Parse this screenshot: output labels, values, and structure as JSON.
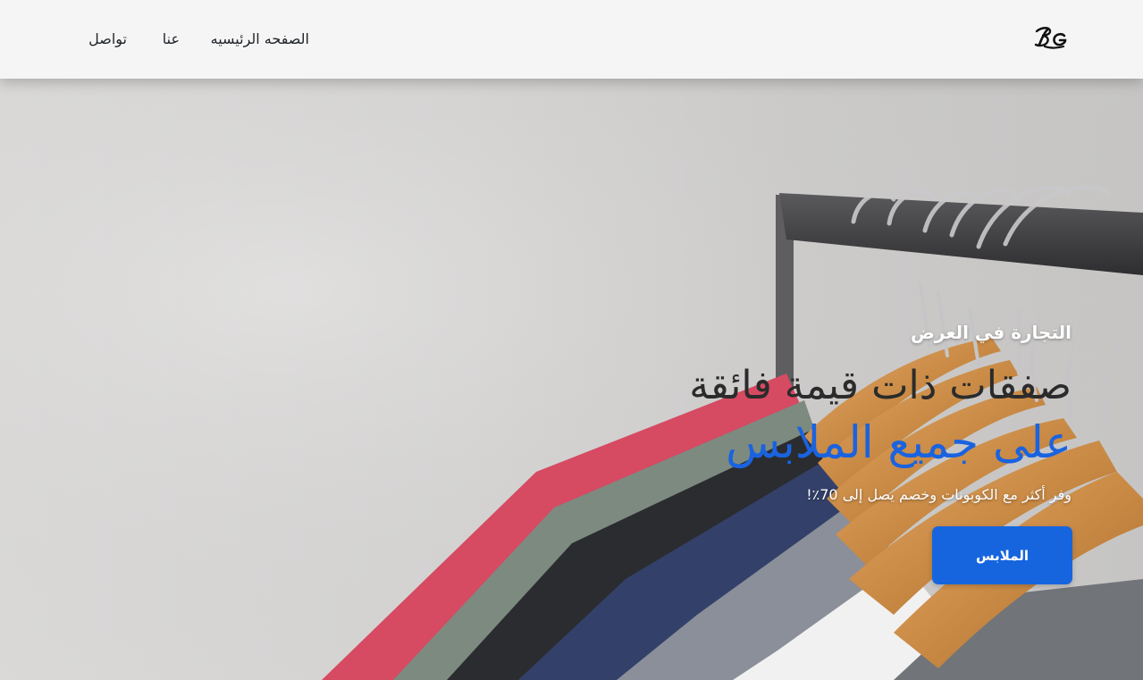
{
  "brand": {
    "logo_text": "BG"
  },
  "nav": {
    "home": "الصفحه الرئيسيه",
    "about": "عنا",
    "contact": "تواصل"
  },
  "hero": {
    "eyebrow": "التجارة في العرض",
    "title_line1": "صفقات ذات قيمة فائقة",
    "title_line2": "على جميع الملابس",
    "subtitle": "وفر أكثر مع الكوبونات وخصم يصل إلى 70٪!",
    "button_label": "الملابس"
  },
  "colors": {
    "accent": "#1665df",
    "title_dark": "#2b2b2b",
    "title_accent": "#1a63e0",
    "header_bg": "#f5f5f5"
  }
}
